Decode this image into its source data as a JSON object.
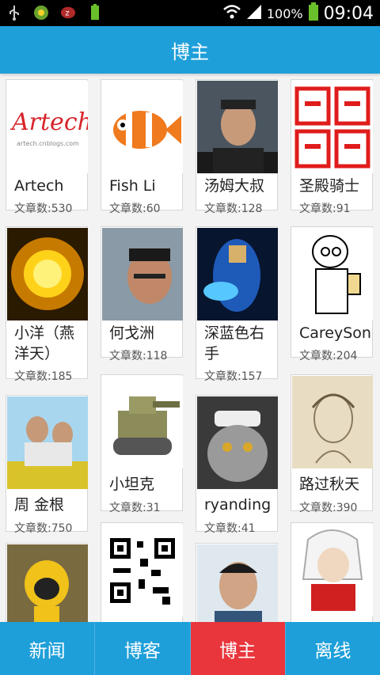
{
  "status_bar": {
    "battery_percent": "100%",
    "time": "09:04",
    "icons": [
      "usb-icon",
      "app-icon",
      "zune-icon",
      "battery-small-icon",
      "wifi-icon",
      "signal-icon",
      "battery-icon"
    ]
  },
  "header": {
    "title": "博主"
  },
  "bloggers": [
    {
      "name": "Artech",
      "count": "文章数:530",
      "avatar": "artech-logo"
    },
    {
      "name": "Fish Li",
      "count": "文章数:60",
      "avatar": "clownfish"
    },
    {
      "name": "汤姆大叔",
      "count": "文章数:128",
      "avatar": "man-photo"
    },
    {
      "name": "圣殿骑士",
      "count": "文章数:91",
      "avatar": "red-seal-text"
    },
    {
      "name": "小洋（燕洋天）",
      "count": "文章数:185",
      "avatar": "sun"
    },
    {
      "name": "何戈洲",
      "count": "文章数:118",
      "avatar": "man-glasses"
    },
    {
      "name": "深蓝色右手",
      "count": "文章数:157",
      "avatar": "blue-figure"
    },
    {
      "name": "CareySon",
      "count": "文章数:204",
      "avatar": "cartoon-scientist"
    },
    {
      "name": "周 金根",
      "count": "文章数:750",
      "avatar": "couple-photo"
    },
    {
      "name": "小坦克",
      "count": "文章数:31",
      "avatar": "tank"
    },
    {
      "name": "ryanding",
      "count": "文章数:41",
      "avatar": "cat-hat"
    },
    {
      "name": "路过秋天",
      "count": "文章数:390",
      "avatar": "sketch-portrait"
    },
    {
      "name": "",
      "count": "",
      "avatar": "yellow-toy"
    },
    {
      "name": "",
      "count": "",
      "avatar": "qr-code"
    },
    {
      "name": "",
      "count": "",
      "avatar": "young-man"
    },
    {
      "name": "",
      "count": "",
      "avatar": "anime-character"
    }
  ],
  "tabs": [
    {
      "label": "新闻",
      "active": false
    },
    {
      "label": "博客",
      "active": false
    },
    {
      "label": "博主",
      "active": true
    },
    {
      "label": "离线",
      "active": false
    }
  ],
  "colors": {
    "primary": "#1e9fd9",
    "active_tab": "#e8363c"
  }
}
